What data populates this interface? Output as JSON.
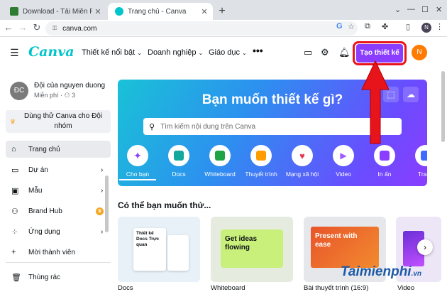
{
  "browser": {
    "tabs": [
      {
        "title": "Download - Tải Miễn Phí VN - Ph",
        "favicon_color": "#2e7d32",
        "active": false
      },
      {
        "title": "Trang chủ - Canva",
        "favicon_color": "#00c4cc",
        "active": true
      }
    ],
    "new_tab": "+",
    "url": "canva.com",
    "profile_initial": "N"
  },
  "header": {
    "logo": "Canva",
    "nav": [
      "Thiết kế nổi bật",
      "Doanh nghiệp",
      "Giáo dục"
    ],
    "create_button": "Tạo thiết kế",
    "avatar_initial": "N"
  },
  "sidebar": {
    "team_initials": "ĐC",
    "team_name": "Đội của nguyen duong",
    "team_plan": "Miễn phí",
    "team_members": "3",
    "trial_line1": "Dùng thử Canva cho Đội",
    "trial_line2": "nhóm",
    "items": [
      {
        "label": "Trang chủ",
        "icon": "home-icon",
        "glyph": "⌂",
        "active": true,
        "chevron": false
      },
      {
        "label": "Dự án",
        "icon": "folder-icon",
        "glyph": "▭",
        "active": false,
        "chevron": true
      },
      {
        "label": "Mẫu",
        "icon": "template-icon",
        "glyph": "▣",
        "active": false,
        "chevron": true
      },
      {
        "label": "Brand Hub",
        "icon": "brand-hub-icon",
        "glyph": "⚇",
        "active": false,
        "chevron": false
      },
      {
        "label": "Ứng dụng",
        "icon": "apps-icon",
        "glyph": "⁘",
        "active": false,
        "chevron": true
      }
    ],
    "invite_label": "Mời thành viên",
    "trash_label": "Thùng rác"
  },
  "hero": {
    "title": "Bạn muốn thiết kế gì?",
    "search_placeholder": "Tìm kiếm nội dung trên Canva",
    "categories": [
      {
        "label": "Cho bạn",
        "color": "#8b3dff",
        "selected": true
      },
      {
        "label": "Docs",
        "color": "#13a89e",
        "selected": false
      },
      {
        "label": "Whiteboard",
        "color": "#1ea446",
        "selected": false
      },
      {
        "label": "Thuyết trình",
        "color": "#ff9d00",
        "selected": false
      },
      {
        "label": "Mạng xã hội",
        "color": "#e8364f",
        "selected": false
      },
      {
        "label": "Video",
        "color": "#a259ff",
        "selected": false
      },
      {
        "label": "In ấn",
        "color": "#8b3dff",
        "selected": false
      },
      {
        "label": "Trang",
        "color": "#3d6bff",
        "selected": false
      }
    ]
  },
  "suggestions": {
    "title": "Có thể bạn muốn thử...",
    "cards": [
      {
        "label": "Docs",
        "headline": "Thiết kế Docs Trực quan",
        "bg": "#e8f1f8"
      },
      {
        "label": "Whiteboard",
        "headline": "Get ideas flowing",
        "bg": "#e6ebe0"
      },
      {
        "label": "Bài thuyết trình (16:9)",
        "headline": "Present with ease",
        "bg": "#e6e7ea"
      },
      {
        "label": "Video",
        "headline": "",
        "bg": "#ece6f6"
      }
    ]
  },
  "watermark": "Taimienphi",
  "watermark_suffix": ".vn"
}
